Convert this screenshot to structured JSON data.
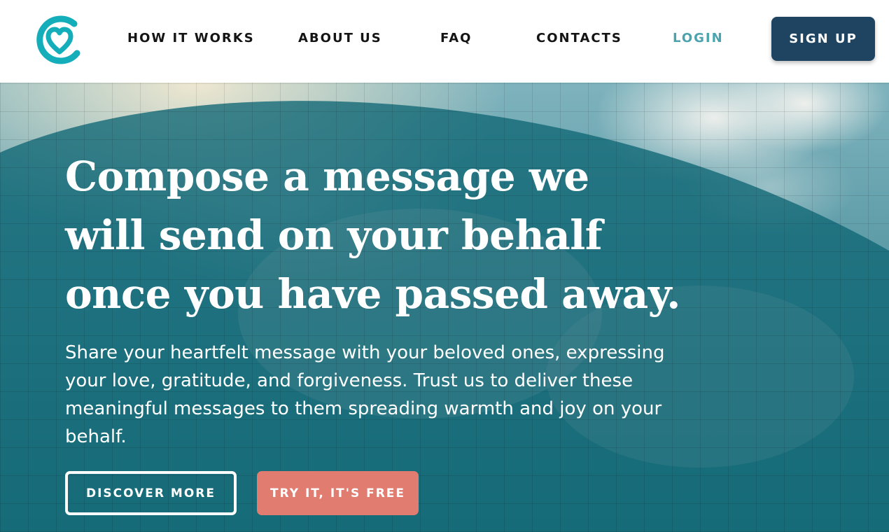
{
  "brand": {
    "logo_icon": "heart-circle-logo-icon",
    "accent": "#14aebb"
  },
  "nav": {
    "items": [
      {
        "label": "HOW IT WORKS"
      },
      {
        "label": "ABOUT US"
      },
      {
        "label": "FAQ"
      },
      {
        "label": "CONTACTS"
      }
    ],
    "login_label": "LOGIN",
    "signup_label": "SIGN UP"
  },
  "hero": {
    "title": "Compose a message we will send on your behalf once you have passed away.",
    "subtitle": "Share your heartfelt message with your beloved ones, expressing your love, gratitude, and forgiveness. Trust us to deliver these meaningful messages to them spreading warmth and joy on your behalf.",
    "discover_label": "DISCOVER MORE",
    "try_label": "TRY IT, IT'S FREE"
  },
  "colors": {
    "signup_bg": "#1e4461",
    "login_text": "#4aa3ad",
    "try_bg": "#e17c70",
    "hero_overlay": "#0f6674"
  }
}
